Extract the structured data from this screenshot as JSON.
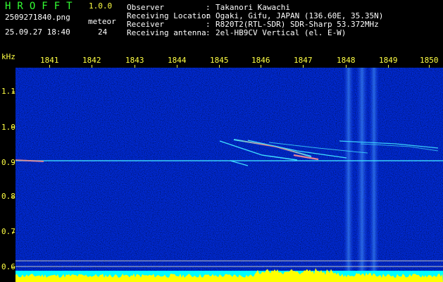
{
  "app": {
    "title": "HROFFT",
    "version": "1.0.0",
    "file_name": "2509271840.png",
    "date_time": "25.09.27 18:40",
    "meteor_label": "meteor",
    "meteor_count": "24"
  },
  "info": [
    {
      "label": "Observer",
      "value": "Takanori Kawachi"
    },
    {
      "label": "Receiving Location",
      "value": "Ogaki, Gifu, JAPAN (136.60E, 35.35N)"
    },
    {
      "label": "Receiver",
      "value": "R820T2(RTL-SDR) SDR-Sharp 53.372MHz"
    },
    {
      "label": "Receiving antenna",
      "value": "2el-HB9CV Vertical (el. E-W)"
    }
  ],
  "colon": ":",
  "axis": {
    "y_unit": "kHz",
    "x_ticks": [
      "1841",
      "1842",
      "1843",
      "1844",
      "1845",
      "1846",
      "1847",
      "1848",
      "1849",
      "1850"
    ],
    "y_ticks": [
      "1.1",
      "1.0",
      "0.9",
      "0.8",
      "0.7",
      "0.6"
    ]
  },
  "colors": {
    "background": "#000000",
    "title_green": "#33ff33",
    "axis_yellow": "#ffff44",
    "spectrum_base": "#00008a",
    "carrier_cyan": "#40e0ff",
    "level_yellow": "#ffff00",
    "level_cyan": "#00ffff"
  }
}
